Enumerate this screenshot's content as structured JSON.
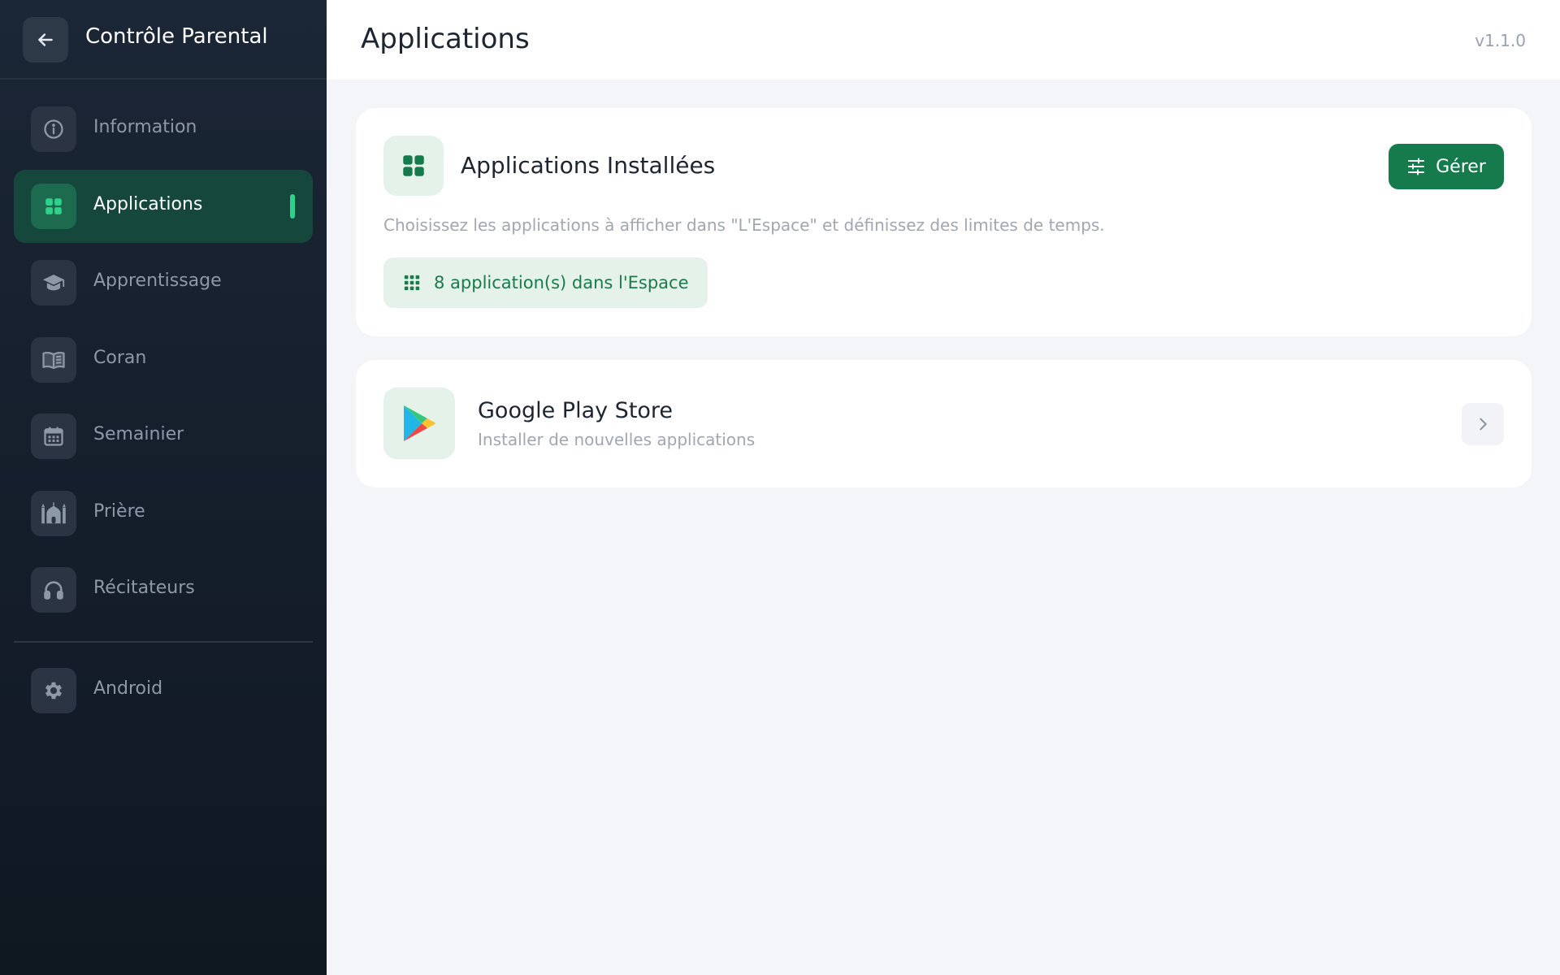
{
  "sidebar": {
    "title": "Contrôle Parental",
    "back_icon": "arrow-left-icon",
    "items": [
      {
        "label": "Information",
        "icon": "info-icon",
        "active": false
      },
      {
        "label": "Applications",
        "icon": "grid-icon",
        "active": true
      },
      {
        "label": "Apprentissage",
        "icon": "graduation-cap-icon",
        "active": false
      },
      {
        "label": "Coran",
        "icon": "book-icon",
        "active": false
      },
      {
        "label": "Semainier",
        "icon": "calendar-icon",
        "active": false
      },
      {
        "label": "Prière",
        "icon": "mosque-icon",
        "active": false
      },
      {
        "label": "Récitateurs",
        "icon": "headphones-icon",
        "active": false
      },
      {
        "label": "Android",
        "icon": "gear-icon",
        "active": false
      }
    ]
  },
  "header": {
    "title": "Applications",
    "version": "v1.1.0"
  },
  "installed_card": {
    "title": "Applications Installées",
    "manage_label": "Gérer",
    "description": "Choisissez les applications à afficher dans \"L'Espace\" et définissez des limites de temps.",
    "count_label": "8 application(s) dans l'Espace"
  },
  "play_store_card": {
    "title": "Google Play Store",
    "subtitle": "Installer de nouvelles applications"
  },
  "colors": {
    "sidebar_bg": "#1b2636",
    "accent": "#157a4c",
    "active_indicator": "#2ed28b",
    "light_green": "#e4f2ea"
  }
}
